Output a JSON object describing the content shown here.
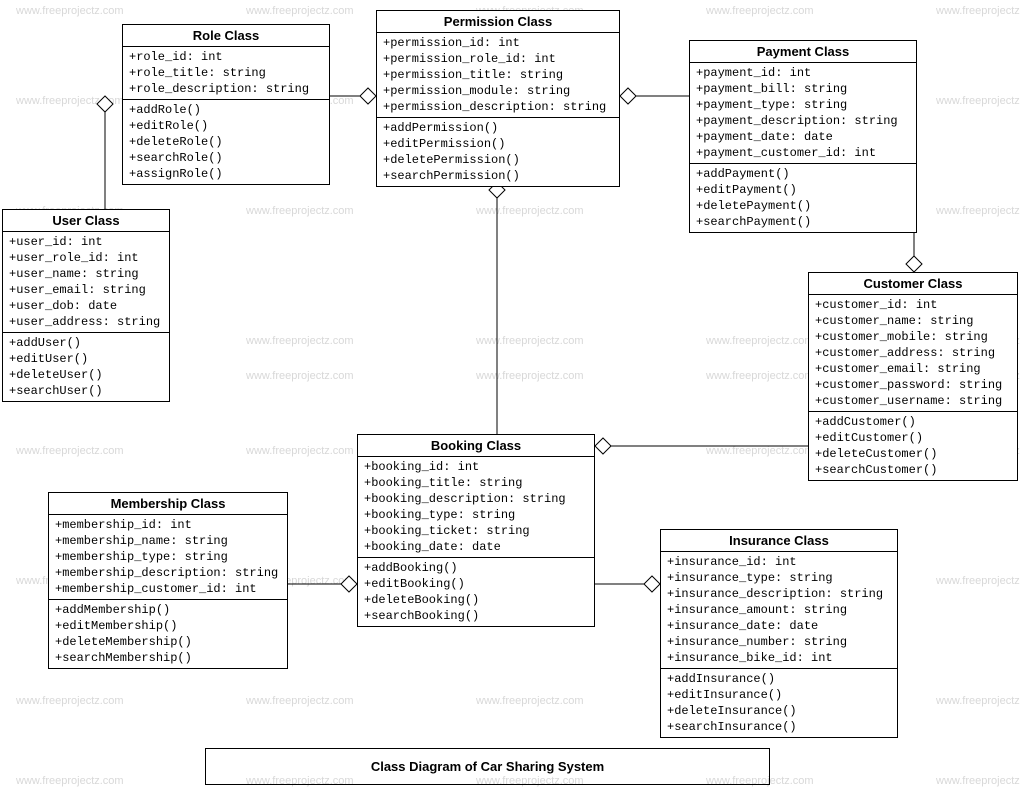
{
  "diagram_title": "Class Diagram of Car Sharing System",
  "watermark_text": "www.freeprojectz.com",
  "classes": {
    "role": {
      "title": "Role Class",
      "attrs": [
        "+role_id: int",
        "+role_title: string",
        "+role_description: string"
      ],
      "methods": [
        "+addRole()",
        "+editRole()",
        "+deleteRole()",
        "+searchRole()",
        "+assignRole()"
      ]
    },
    "permission": {
      "title": "Permission Class",
      "attrs": [
        "+permission_id: int",
        "+permission_role_id: int",
        "+permission_title: string",
        "+permission_module: string",
        "+permission_description: string"
      ],
      "methods": [
        "+addPermission()",
        "+editPermission()",
        "+deletePermission()",
        "+searchPermission()"
      ]
    },
    "payment": {
      "title": "Payment Class",
      "attrs": [
        "+payment_id: int",
        "+payment_bill: string",
        "+payment_type: string",
        "+payment_description: string",
        "+payment_date: date",
        "+payment_customer_id: int"
      ],
      "methods": [
        "+addPayment()",
        "+editPayment()",
        "+deletePayment()",
        "+searchPayment()"
      ]
    },
    "user": {
      "title": "User Class",
      "attrs": [
        "+user_id: int",
        "+user_role_id: int",
        "+user_name: string",
        "+user_email: string",
        "+user_dob: date",
        "+user_address: string"
      ],
      "methods": [
        "+addUser()",
        "+editUser()",
        "+deleteUser()",
        "+searchUser()"
      ]
    },
    "customer": {
      "title": "Customer Class",
      "attrs": [
        "+customer_id: int",
        "+customer_name: string",
        "+customer_mobile: string",
        "+customer_address: string",
        "+customer_email: string",
        "+customer_password: string",
        "+customer_username: string"
      ],
      "methods": [
        "+addCustomer()",
        "+editCustomer()",
        "+deleteCustomer()",
        "+searchCustomer()"
      ]
    },
    "booking": {
      "title": "Booking Class",
      "attrs": [
        "+booking_id: int",
        "+booking_title: string",
        "+booking_description: string",
        "+booking_type: string",
        "+booking_ticket: string",
        "+booking_date: date"
      ],
      "methods": [
        "+addBooking()",
        "+editBooking()",
        "+deleteBooking()",
        "+searchBooking()"
      ]
    },
    "membership": {
      "title": "Membership Class",
      "attrs": [
        "+membership_id: int",
        "+membership_name: string",
        "+membership_type: string",
        "+membership_description: string",
        "+membership_customer_id: int"
      ],
      "methods": [
        "+addMembership()",
        "+editMembership()",
        "+deleteMembership()",
        "+searchMembership()"
      ]
    },
    "insurance": {
      "title": "Insurance Class",
      "attrs": [
        "+insurance_id: int",
        "+insurance_type: string",
        "+insurance_description: string",
        "+insurance_amount: string",
        "+insurance_date: date",
        "+insurance_number: string",
        "+insurance_bike_id: int"
      ],
      "methods": [
        "+addInsurance()",
        "+editInsurance()",
        "+deleteInsurance()",
        "+searchInsurance()"
      ]
    }
  }
}
